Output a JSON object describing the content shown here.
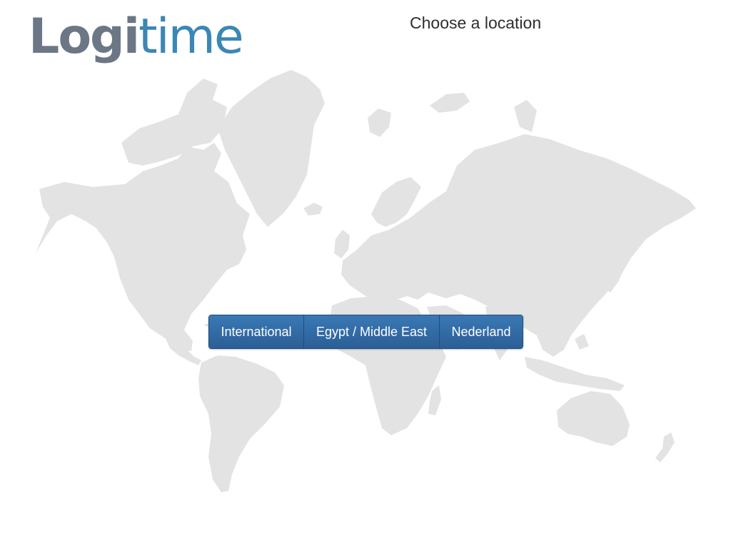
{
  "header": {
    "logo_part1": "Logi",
    "logo_part2": "time",
    "heading": "Choose a location"
  },
  "locations": [
    {
      "label": "International"
    },
    {
      "label": "Egypt / Middle East"
    },
    {
      "label": "Nederland"
    }
  ],
  "colors": {
    "logo_gray": "#6b7785",
    "logo_blue": "#3b87b5",
    "button_blue": "#2b5f96",
    "map_gray": "#e3e3e3"
  }
}
